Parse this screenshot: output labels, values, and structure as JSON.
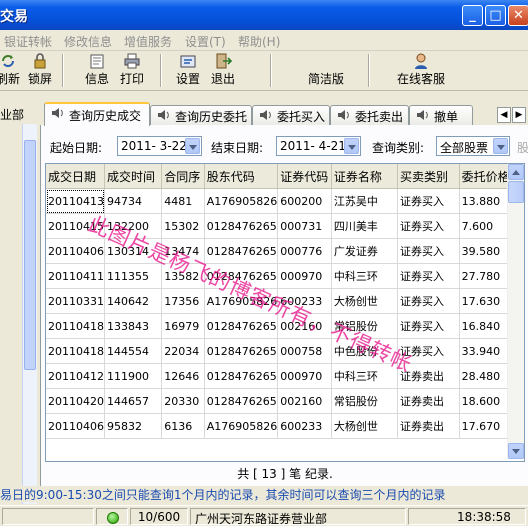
{
  "window": {
    "title": "交易",
    "minimize_glyph": "_",
    "maximize_glyph": "□",
    "close_glyph": "✕"
  },
  "menu": {
    "items": [
      "银证转帐",
      "修改信息",
      "增值服务",
      "设置(T)",
      "帮助(H)"
    ]
  },
  "toolbar": {
    "refresh_label": "刷新",
    "lock_label": "锁屏",
    "info_label": "信息",
    "print_label": "打印",
    "settings_label": "设置",
    "exit_label": "退出",
    "simple_label": "简洁版",
    "service_label": "在线客服"
  },
  "left_panel": {
    "header": "业部"
  },
  "tabs": {
    "items": [
      {
        "label": "查询历史成交",
        "active": true
      },
      {
        "label": "查询历史委托",
        "active": false
      },
      {
        "label": "委托买入",
        "active": false
      },
      {
        "label": "委托卖出",
        "active": false
      },
      {
        "label": "撤单",
        "active": false
      }
    ],
    "prev_glyph": "◀",
    "next_glyph": "▶"
  },
  "filters": {
    "start_label": "起始日期:",
    "start_value": "2011- 3-22",
    "end_label": "结束日期:",
    "end_value": "2011- 4-21",
    "type_label": "查询类别:",
    "type_value": "全部股票",
    "extra_label": "股"
  },
  "table": {
    "columns": [
      "成交日期",
      "成交时间",
      "合同序",
      "股东代码",
      "证券代码",
      "证券名称",
      "买卖类别",
      "委托价格"
    ],
    "rows": [
      [
        "20110413",
        "94734",
        "4481",
        "A176905826",
        "600200",
        "江苏吴中",
        "证券买入",
        "13.880"
      ],
      [
        "20110415",
        "132200",
        "15302",
        "0128476265",
        "000731",
        "四川美丰",
        "证券买入",
        "7.600"
      ],
      [
        "20110406",
        "130314",
        "13474",
        "0128476265",
        "000776",
        "广发证券",
        "证券买入",
        "39.580"
      ],
      [
        "20110411",
        "111355",
        "13582",
        "0128476265",
        "000970",
        "中科三环",
        "证券买入",
        "27.780"
      ],
      [
        "20110331",
        "140642",
        "17356",
        "A176905826",
        "600233",
        "大杨创世",
        "证券买入",
        "17.630"
      ],
      [
        "20110418",
        "133843",
        "16979",
        "0128476265",
        "002160",
        "常铝股份",
        "证券买入",
        "16.840"
      ],
      [
        "20110418",
        "144554",
        "22034",
        "0128476265",
        "000758",
        "中色股份",
        "证券买入",
        "33.940"
      ],
      [
        "20110412",
        "111900",
        "12646",
        "0128476265",
        "000970",
        "中科三环",
        "证券卖出",
        "28.480"
      ],
      [
        "20110420",
        "144657",
        "20330",
        "0128476265",
        "002160",
        "常铝股份",
        "证券卖出",
        "18.600"
      ],
      [
        "20110406",
        "95832",
        "6136",
        "A176905826",
        "600233",
        "大杨创世",
        "证券卖出",
        "17.670"
      ]
    ]
  },
  "summary": "共 [ 13 ] 笔 纪录.",
  "notice": "易日的9:00-15:30之间只能查询1个月内的记录，其余时间可以查询三个月内的记录",
  "status": {
    "count": "10/600",
    "branch": "广州天河东路证券营业部",
    "time": "18:38:58"
  },
  "watermark": "此图片是杨飞的博客所有，不得转帐",
  "colors": {
    "titlebar": "#0550d8",
    "notice_text": "#1a4bb0",
    "watermark": "#e8148c",
    "active_tab_accent": "#ffc83c"
  }
}
